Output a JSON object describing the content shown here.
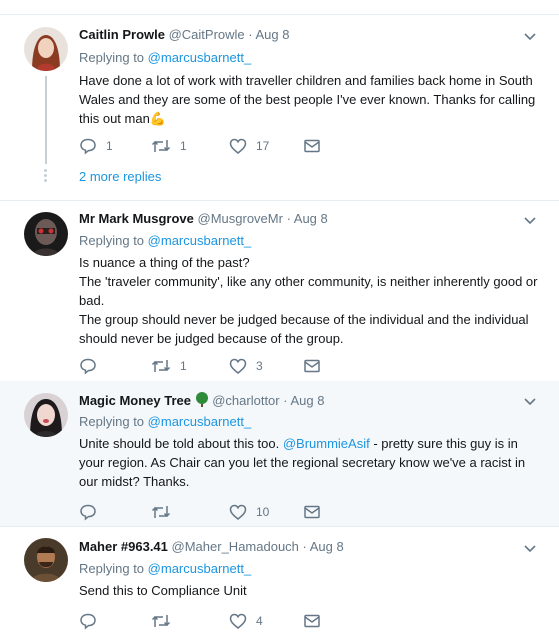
{
  "tweets": [
    {
      "name": "Caitlin Prowle",
      "handle": "@CaitProwle",
      "date": "· Aug 8",
      "replying_label": "Replying to",
      "replying_to": "@marcusbarnett_",
      "body": [
        "Have done a lot of work with traveller children and families back home in South Wales and they are some of the best people I've ever known. Thanks for calling this out man"
      ],
      "emoji": "💪",
      "reply_count": "1",
      "retweet_count": "1",
      "like_count": "17",
      "more_replies": "2 more replies"
    },
    {
      "name": "Mr Mark Musgrove",
      "handle": "@MusgroveMr",
      "date": "· Aug 8",
      "replying_label": "Replying to",
      "replying_to": "@marcusbarnett_",
      "body": [
        "Is nuance a thing of the past?",
        "The 'traveler community', like any other community, is neither inherently good or bad.",
        "The group should never be judged because of the individual and the individual should never be judged because of the group."
      ],
      "reply_count": "",
      "retweet_count": "1",
      "like_count": "3"
    },
    {
      "name": "Magic Money Tree",
      "name_icon": "tree-icon",
      "handle": "@charlottor",
      "date": "· Aug 8",
      "replying_label": "Replying to",
      "replying_to": "@marcusbarnett_",
      "body_pre": "Unite should be told about this too.",
      "body_mention": "@BrummieAsif",
      "body_post": "- pretty sure this guy is in your region. As Chair can you let the regional secretary know we've a racist in our midst? Thanks.",
      "reply_count": "",
      "retweet_count": "",
      "like_count": "10"
    },
    {
      "name": "Maher #963.41",
      "handle": "@Maher_Hamadouch",
      "date": "· Aug 8",
      "replying_label": "Replying to",
      "replying_to": "@marcusbarnett_",
      "body": [
        "Send this to Compliance Unit"
      ],
      "reply_count": "",
      "retweet_count": "",
      "like_count": "4"
    }
  ],
  "colors": {
    "link": "#1b95e0",
    "muted": "#657786",
    "text": "#14171a",
    "highlight_bg": "#f5f8fa",
    "tree": "#2e8b3a"
  }
}
